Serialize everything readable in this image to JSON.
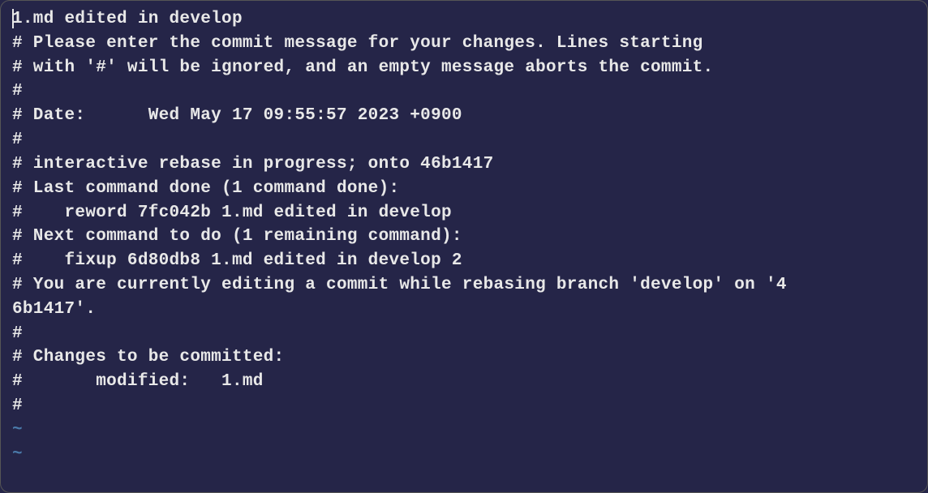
{
  "editor": {
    "commit_message": "1.md edited in develop",
    "lines": [
      "",
      "# Please enter the commit message for your changes. Lines starting",
      "# with '#' will be ignored, and an empty message aborts the commit.",
      "#",
      "# Date:      Wed May 17 09:55:57 2023 +0900",
      "#",
      "# interactive rebase in progress; onto 46b1417",
      "# Last command done (1 command done):",
      "#    reword 7fc042b 1.md edited in develop",
      "# Next command to do (1 remaining command):",
      "#    fixup 6d80db8 1.md edited in develop 2",
      "# You are currently editing a commit while rebasing branch 'develop' on '4",
      "6b1417'.",
      "#",
      "# Changes to be committed:",
      "#       modified:   1.md",
      "#"
    ],
    "tilde": "~"
  }
}
